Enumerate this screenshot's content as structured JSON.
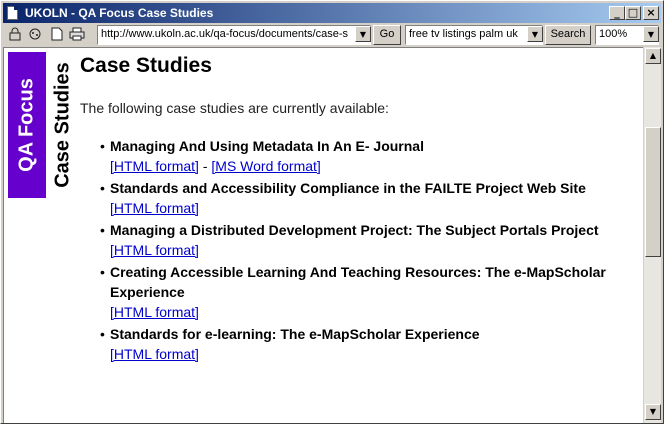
{
  "window": {
    "title": "UKOLN - QA Focus Case Studies"
  },
  "titlebar_buttons": {
    "minimize": "_",
    "maximize": "□",
    "close": "×"
  },
  "toolbar": {
    "icons": [
      "lock-icon",
      "cookie-icon",
      "document-icon",
      "printer-icon"
    ],
    "url": "http://www.ukoln.ac.uk/qa-focus/documents/case-s",
    "go_label": "Go",
    "search_value": "free tv listings palm uk",
    "search_label": "Search",
    "zoom_value": "100%"
  },
  "sidebar": {
    "brand_label": "QA Focus",
    "section_label": "Case Studies",
    "brand_color": "#6600cc"
  },
  "main": {
    "title": "Case Studies",
    "intro": "The following case studies are currently available:",
    "cases": [
      {
        "title": "Managing And Using Metadata In An E- Journal",
        "link1": "[HTML format]",
        "separator": "-",
        "link2": "[MS Word format]"
      },
      {
        "title": "Standards and Accessibility Compliance in the FAILTE Project Web Site",
        "link1": "[HTML format]"
      },
      {
        "title": "Managing a Distributed Development Project: The Subject Portals Project",
        "link1": "[HTML format]"
      },
      {
        "title": "Creating Accessible Learning And Teaching Resources: The e-MapScholar Experience",
        "link1": "[HTML format]"
      },
      {
        "title": "Standards for e-learning: The e-MapScholar Experience",
        "link1": "[HTML format]"
      }
    ]
  },
  "colors": {
    "titlebar_start": "#0a246a",
    "link": "#0000cc"
  }
}
